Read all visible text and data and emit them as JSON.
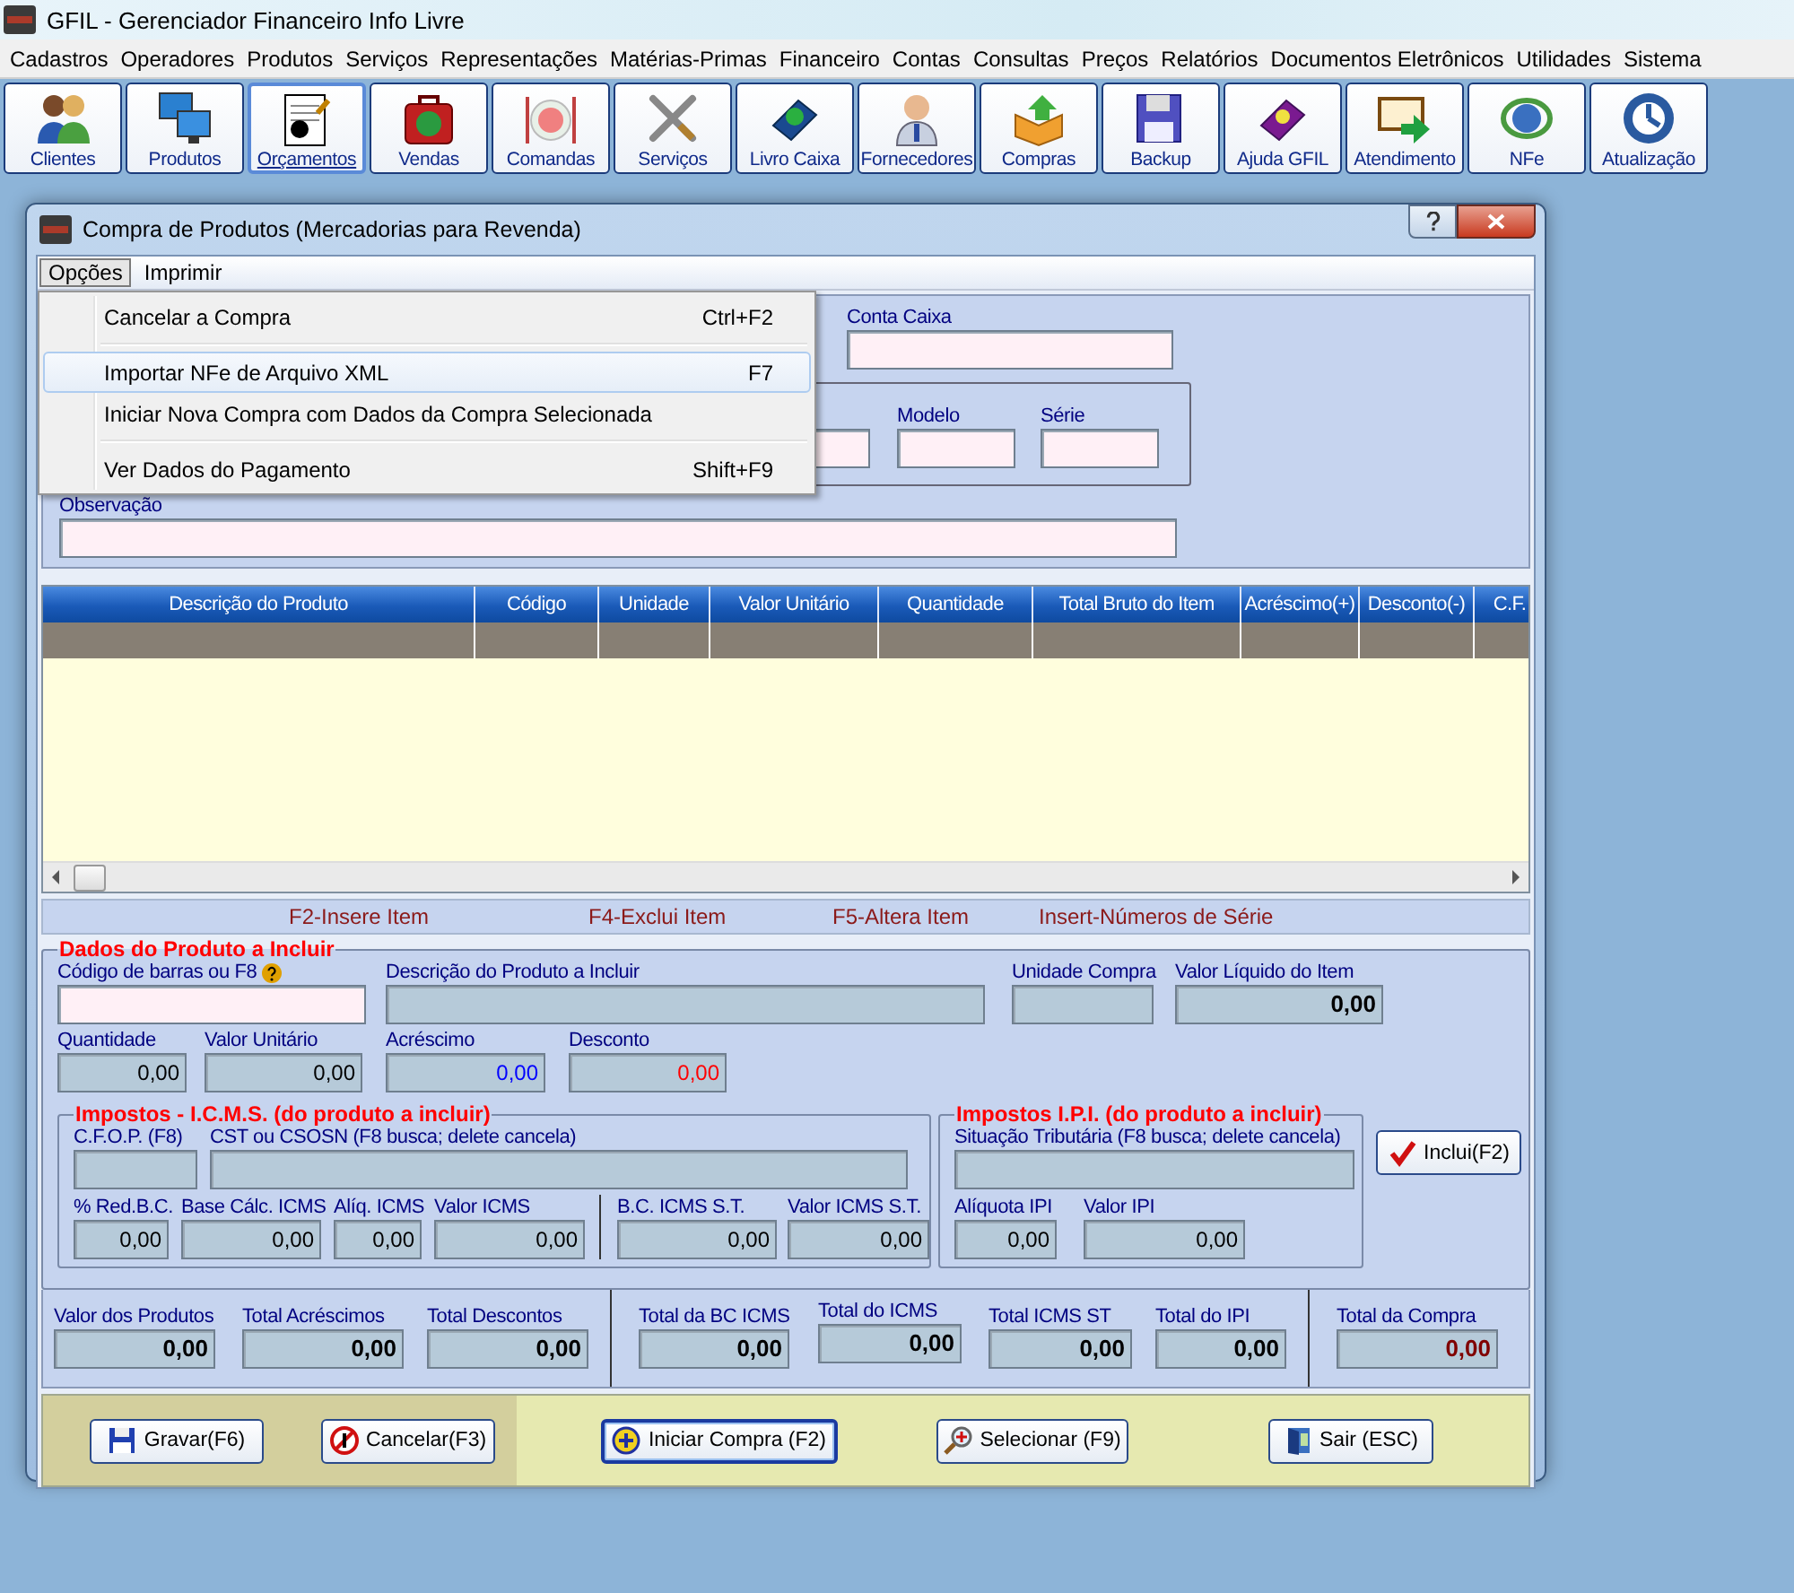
{
  "app": {
    "title": "GFIL - Gerenciador Financeiro Info Livre"
  },
  "menu": [
    "Cadastros",
    "Operadores",
    "Produtos",
    "Serviços",
    "Representações",
    "Matérias-Primas",
    "Financeiro",
    "Contas",
    "Consultas",
    "Preços",
    "Relatórios",
    "Documentos Eletrônicos",
    "Utilidades",
    "Sistema"
  ],
  "toolbar": [
    {
      "label": "Clientes",
      "selected": false
    },
    {
      "label": "Produtos",
      "selected": false
    },
    {
      "label": "Orçamentos",
      "selected": true
    },
    {
      "label": "Vendas",
      "selected": false
    },
    {
      "label": "Comandas",
      "selected": false
    },
    {
      "label": "Serviços",
      "selected": false
    },
    {
      "label": "Livro Caixa",
      "selected": false
    },
    {
      "label": "Fornecedores",
      "selected": false
    },
    {
      "label": "Compras",
      "selected": false
    },
    {
      "label": "Backup",
      "selected": false
    },
    {
      "label": "Ajuda GFIL",
      "selected": false
    },
    {
      "label": "Atendimento",
      "selected": false
    },
    {
      "label": "NFe",
      "selected": false
    },
    {
      "label": "Atualização",
      "selected": false
    }
  ],
  "dialog": {
    "title": "Compra de Produtos (Mercadorias para Revenda)",
    "menu": [
      {
        "label": "Opções",
        "selected": true
      },
      {
        "label": "Imprimir",
        "selected": false
      }
    ],
    "dropdown": [
      {
        "label": "Cancelar a Compra",
        "shortcut": "Ctrl+F2",
        "selected": false,
        "separator_after": true
      },
      {
        "label": "Importar NFe de Arquivo XML",
        "shortcut": "F7",
        "selected": true,
        "separator_after": false
      },
      {
        "label": "Iniciar Nova Compra com Dados da Compra Selecionada",
        "selected": false,
        "separator_after": true
      },
      {
        "label": "Ver Dados do Pagamento",
        "shortcut": "Shift+F9",
        "selected": false,
        "separator_after": false
      }
    ]
  },
  "header_fields": [
    {
      "label": "Conta Caixa",
      "editable": true
    },
    {
      "editable": true
    },
    {
      "label": "Modelo",
      "editable": true
    },
    {
      "label": "Série",
      "editable": true
    },
    {
      "label": "Observação",
      "editable": true
    }
  ],
  "grid": {
    "columns": [
      "Descrição do Produto",
      "Código",
      "Unidade",
      "Valor Unitário",
      "Quantidade",
      "Total Bruto do Item",
      "Acréscimo(+)",
      "Desconto(-)",
      "C.F."
    ]
  },
  "hints": [
    "F2-Insere Item",
    "F4-Exclui Item",
    "F5-Altera Item",
    "Insert-Números de Série"
  ],
  "product": {
    "title": "Dados do Produto a Incluir",
    "fields": [
      {
        "label": "Código de barras ou F8",
        "editable": true,
        "help": true
      },
      {
        "label": "Descrição do Produto a Incluir",
        "editable": false
      },
      {
        "label": "Unidade Compra",
        "editable": false
      },
      {
        "label": "Valor Líquido do Item",
        "editable": false,
        "value": "0,00",
        "bold": true,
        "color": "#000000"
      },
      {
        "label": "Quantidade",
        "editable": false,
        "value": "0,00",
        "color": "#000000"
      },
      {
        "label": "Valor Unitário",
        "editable": false,
        "value": "0,00",
        "color": "#000000"
      },
      {
        "label": "Acréscimo",
        "editable": false,
        "value": "0,00",
        "color": "#0000ff"
      },
      {
        "label": "Desconto",
        "editable": false,
        "value": "0,00",
        "color": "#ff0000"
      }
    ]
  },
  "icms": {
    "title": "Impostos - I.C.M.S. (do produto a incluir)",
    "fields": [
      {
        "label": "C.F.O.P. (F8)",
        "editable": false
      },
      {
        "label": "CST ou CSOSN (F8 busca; delete cancela)",
        "editable": false
      },
      {
        "label": "% Red.B.C.",
        "editable": false,
        "value": "0,00",
        "color": "#000000"
      },
      {
        "label": "Base Cálc. ICMS",
        "editable": false,
        "value": "0,00",
        "color": "#000000"
      },
      {
        "label": "Alíq. ICMS",
        "editable": false,
        "value": "0,00",
        "color": "#000000"
      },
      {
        "label": "Valor ICMS",
        "editable": false,
        "value": "0,00",
        "color": "#000000"
      },
      {
        "label": "B.C. ICMS S.T.",
        "editable": false,
        "value": "0,00",
        "color": "#000000"
      },
      {
        "label": "Valor ICMS S.T.",
        "editable": false,
        "value": "0,00",
        "color": "#000000"
      }
    ]
  },
  "ipi": {
    "title": "Impostos I.P.I. (do produto a incluir)",
    "fields": [
      {
        "label": "Situação Tributária (F8 busca; delete cancela)",
        "editable": false
      },
      {
        "label": "Alíquota IPI",
        "editable": false,
        "value": "0,00",
        "color": "#000000"
      },
      {
        "label": "Valor IPI",
        "editable": false,
        "value": "0,00",
        "color": "#000000"
      }
    ]
  },
  "include_button": "Inclui(F2)",
  "totals": [
    {
      "label": "Valor dos Produtos",
      "value": "0,00",
      "bold": true,
      "color": "#000000",
      "editable": false
    },
    {
      "label": "Total Acréscimos",
      "value": "0,00",
      "bold": true,
      "color": "#000000",
      "editable": false
    },
    {
      "label": "Total Descontos",
      "value": "0,00",
      "bold": true,
      "color": "#000000",
      "editable": false
    },
    {
      "label": "Total da BC ICMS",
      "value": "0,00",
      "bold": true,
      "color": "#000000",
      "editable": false
    },
    {
      "label": "Total do ICMS",
      "value": "0,00",
      "bold": true,
      "color": "#000000",
      "editable": false
    },
    {
      "label": "Total ICMS ST",
      "value": "0,00",
      "bold": true,
      "color": "#000000",
      "editable": false
    },
    {
      "label": "Total do IPI",
      "value": "0,00",
      "bold": true,
      "color": "#000000",
      "editable": false
    },
    {
      "label": "Total da Compra",
      "value": "0,00",
      "bold": true,
      "color": "#800000",
      "editable": false
    }
  ],
  "buttons": [
    {
      "label": "Gravar(F6)",
      "focused": false
    },
    {
      "label": "Cancelar(F3)",
      "focused": false
    },
    {
      "label": "Iniciar Compra (F2)",
      "focused": true
    },
    {
      "label": "Selecionar (F9)",
      "focused": false
    },
    {
      "label": "Sair (ESC)",
      "focused": false
    }
  ]
}
